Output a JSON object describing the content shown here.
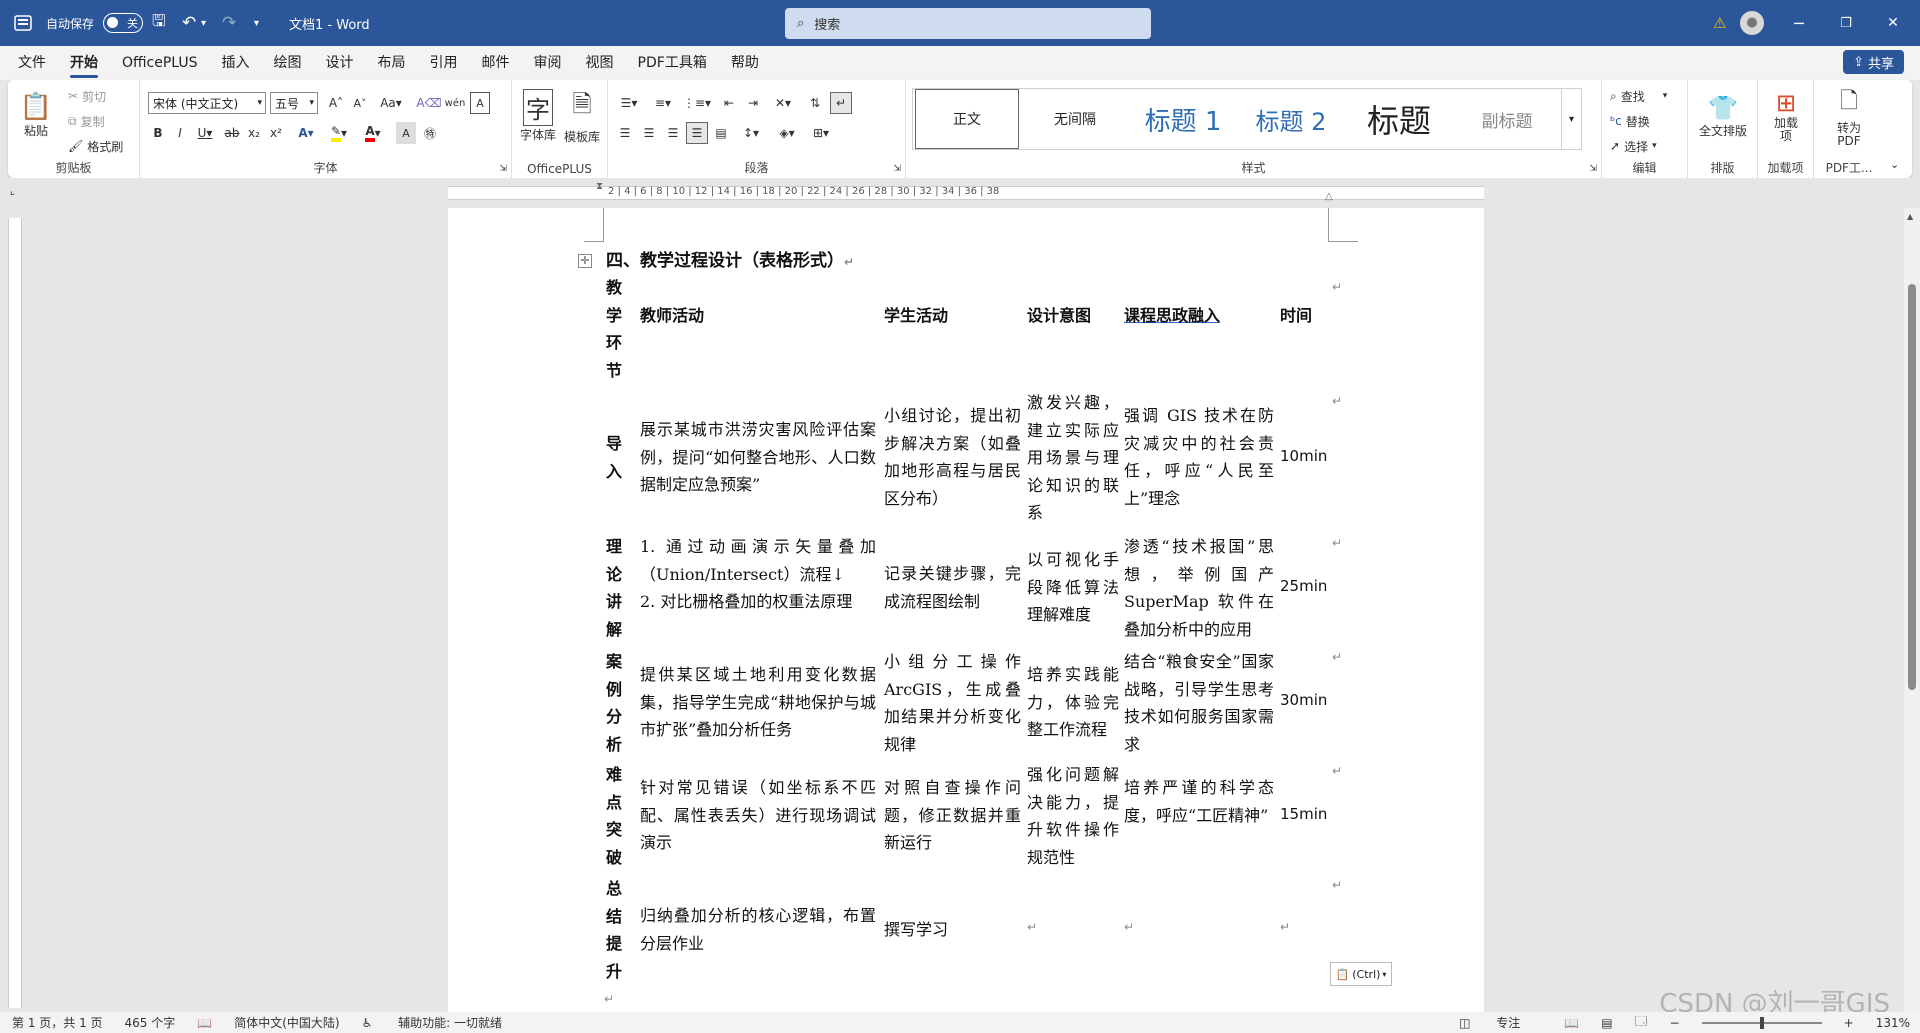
{
  "titlebar": {
    "autosave_label": "自动保存",
    "autosave_state": "关",
    "doc_title": "文档1 - Word",
    "search_placeholder": "搜索",
    "warning_icon": "warning-icon",
    "minimize": "─",
    "restore": "❐",
    "close": "✕"
  },
  "menu": {
    "items": [
      "文件",
      "开始",
      "OfficePLUS",
      "插入",
      "绘图",
      "设计",
      "布局",
      "引用",
      "邮件",
      "审阅",
      "视图",
      "PDF工具箱",
      "帮助"
    ],
    "active": "开始",
    "share_label": "共享"
  },
  "ribbon": {
    "clipboard": {
      "paste": "粘贴",
      "cut": "剪切",
      "copy": "复制",
      "format_painter": "格式刷",
      "label": "剪贴板"
    },
    "font": {
      "name": "宋体 (中文正文)",
      "size": "五号",
      "label": "字体"
    },
    "officeplus": {
      "font_lib": "字体库",
      "template_lib": "模板库",
      "label": "OfficePLUS"
    },
    "paragraph": {
      "label": "段落"
    },
    "styles": {
      "items": [
        "正文",
        "无间隔",
        "标题 1",
        "标题 2",
        "标题",
        "副标题"
      ],
      "label": "样式"
    },
    "editing": {
      "find": "查找",
      "replace": "替换",
      "select": "选择",
      "label": "编辑"
    },
    "layout": {
      "full_layout": "全文排版",
      "label": "排版"
    },
    "addins": {
      "addin": "加载项",
      "label": "加载项"
    },
    "pdf": {
      "convert": "转为PDF",
      "label": "PDF工..."
    },
    "accent": "#2b579a"
  },
  "ruler": {
    "numbers": "2 | 4 | 6 | 8 | 10 | 12 | 14 | 16 | 18 | 20 | 22 | 24 | 26 | 28 | 30 | 32 | 34 | 36 | 38"
  },
  "document": {
    "heading": "四、教学过程设计（表格形式）",
    "headers": [
      "教学环节",
      "教师活动",
      "学生活动",
      "设计意图",
      "课程思政融入",
      "时间"
    ],
    "rows": [
      {
        "stage": "导入",
        "teacher": "展示某城市洪涝灾害风险评估案例，提问“如何整合地形、人口数据制定应急预案”",
        "student": "小组讨论，提出初步解决方案（如叠加地形高程与居民区分布）",
        "intent": "激发兴趣，建立实际应用场景与理论知识的联系",
        "ideology": "强调 GIS 技术在防灾减灾中的社会责任，呼应“人民至上”理念",
        "time": "10min"
      },
      {
        "stage": "理论讲解",
        "teacher": "1.  通过动画演示矢量叠加（Union/Intersect）流程↓\n2.  对比栅格叠加的权重法原理",
        "student": "记录关键步骤，完成流程图绘制",
        "intent": "以可视化手段降低算法理解难度",
        "ideology": "渗透“技术报国”思想，举例国产 SuperMap 软件在叠加分析中的应用",
        "time": "25min"
      },
      {
        "stage": "案例分析",
        "teacher": "提供某区域土地利用变化数据集，指导学生完成“耕地保护与城市扩张”叠加分析任务",
        "student": "小组分工操作ArcGIS，生成叠加结果并分析变化规律",
        "intent": "培养实践能力，体验完整工作流程",
        "ideology": "结合“粮食安全”国家战略，引导学生思考技术如何服务国家需求",
        "time": "30min"
      },
      {
        "stage": "难点突破",
        "teacher": "针对常见错误（如坐标系不匹配、属性表丢失）进行现场调试演示",
        "student": "对照自查操作问题，修正数据并重新运行",
        "intent": "强化问题解决能力，提升软件操作规范性",
        "ideology": "培养严谨的科学态度，呼应“工匠精神”",
        "time": "15min"
      },
      {
        "stage": "总结提升",
        "teacher": "归纳叠加分析的核心逻辑，布置分层作业",
        "student": "撰写学习",
        "intent": "",
        "ideology": "",
        "time": ""
      }
    ],
    "paste_options": "(Ctrl)"
  },
  "status": {
    "page": "第 1 页，共 1 页",
    "words": "465 个字",
    "language": "简体中文(中国大陆)",
    "accessibility": "辅助功能: 一切就绪",
    "focus": "专注",
    "zoom": "131%"
  },
  "watermark": "CSDN @刘一哥GIS"
}
